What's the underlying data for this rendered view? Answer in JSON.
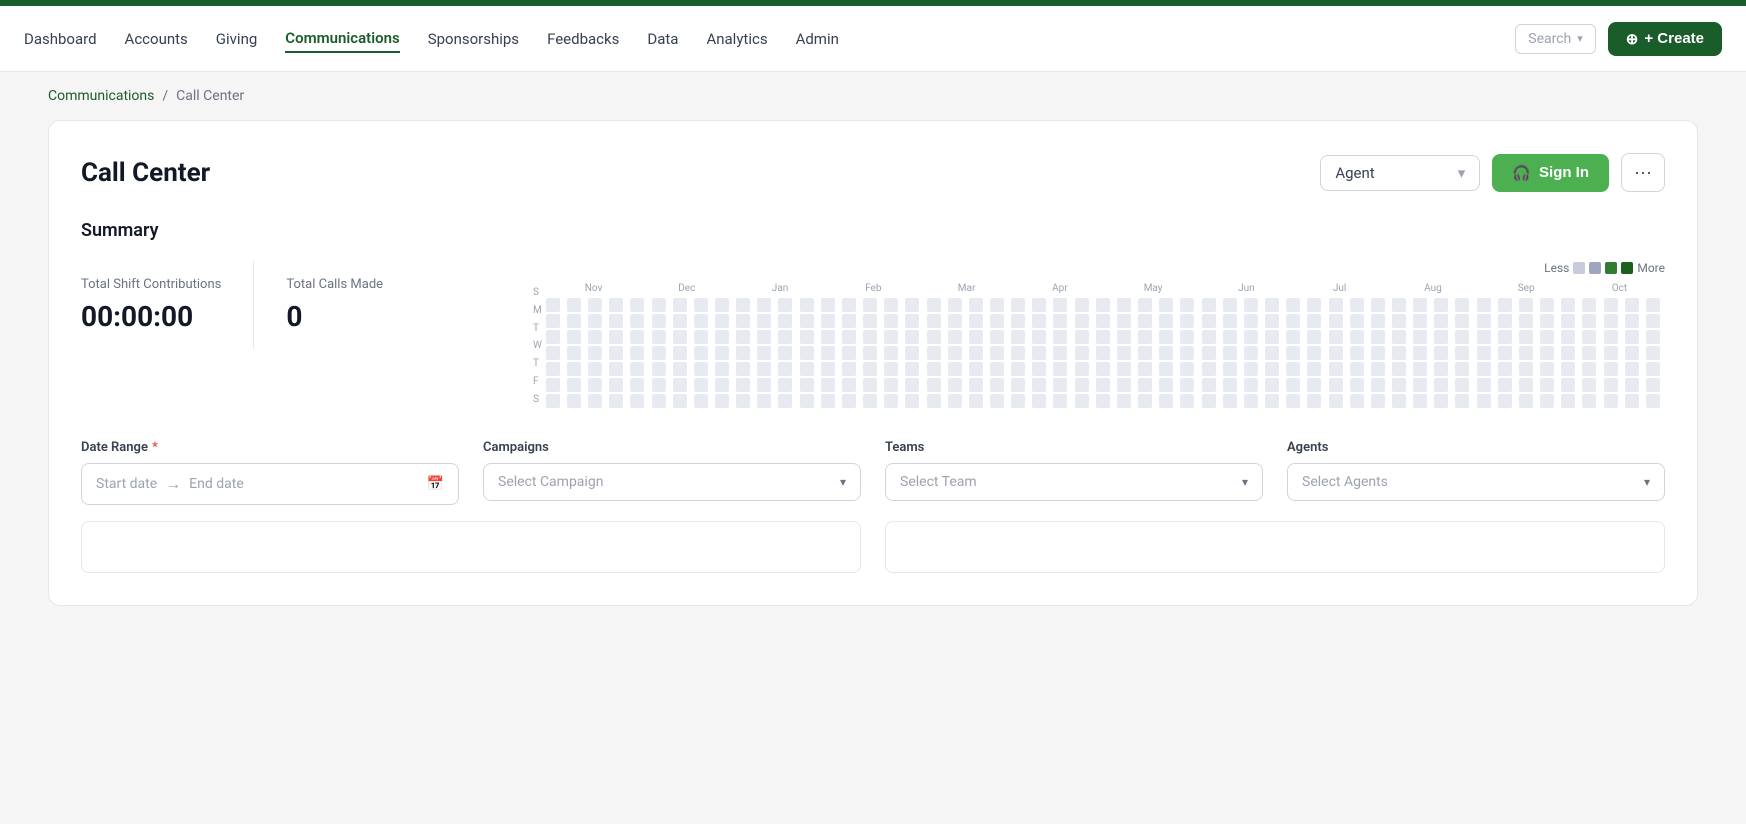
{
  "topbar": {
    "stripe_color": "#1a5c2a",
    "nav_items": [
      {
        "label": "Dashboard",
        "active": false
      },
      {
        "label": "Accounts",
        "active": false
      },
      {
        "label": "Giving",
        "active": false
      },
      {
        "label": "Communications",
        "active": true
      },
      {
        "label": "Sponsorships",
        "active": false
      },
      {
        "label": "Feedbacks",
        "active": false
      },
      {
        "label": "Data",
        "active": false
      },
      {
        "label": "Analytics",
        "active": false
      },
      {
        "label": "Admin",
        "active": false
      }
    ],
    "search_label": "Search",
    "create_label": "+ Create"
  },
  "breadcrumb": {
    "parent": "Communications",
    "separator": "/",
    "current": "Call Center"
  },
  "page": {
    "title": "Call Center",
    "agent_select_label": "Agent",
    "sign_in_label": "Sign In",
    "more_dots": "···"
  },
  "summary": {
    "title": "Summary",
    "stats": [
      {
        "label": "Total Shift Contributions",
        "value": "00:00:00"
      },
      {
        "label": "Total Calls Made",
        "value": "0"
      }
    ],
    "heatmap": {
      "legend": {
        "less_label": "Less",
        "more_label": "More",
        "colors": [
          "#c8cbdc",
          "#9fa5c0",
          "#2e7d32",
          "#1b5e20"
        ]
      },
      "day_labels": [
        "S",
        "M",
        "T",
        "W",
        "T",
        "F",
        "S"
      ],
      "month_labels": [
        "Nov",
        "Dec",
        "Jan",
        "Feb",
        "Mar",
        "Apr",
        "May",
        "Jun",
        "Jul",
        "Aug",
        "Sep",
        "Oct"
      ]
    }
  },
  "filters": {
    "date_range": {
      "label": "Date Range",
      "required": true,
      "start_placeholder": "Start date",
      "end_placeholder": "End date"
    },
    "campaigns": {
      "label": "Campaigns",
      "placeholder": "Select Campaign"
    },
    "teams": {
      "label": "Teams",
      "placeholder": "Select Team"
    },
    "agents": {
      "label": "Agents",
      "placeholder": "Select Agents"
    }
  }
}
